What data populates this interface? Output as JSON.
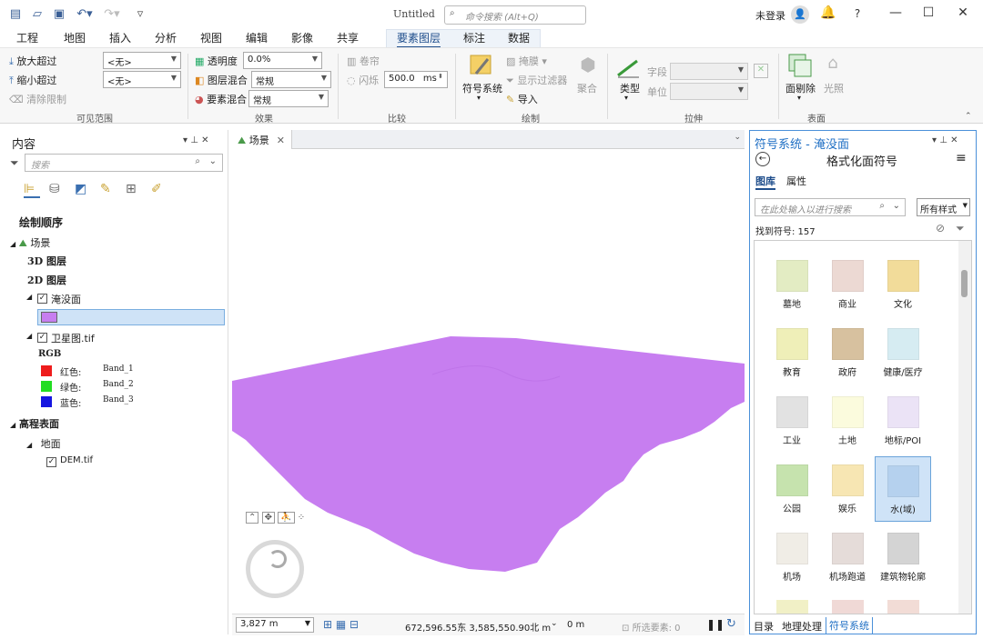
{
  "app": {
    "title": "Untitled",
    "search_placeholder": "命令搜索 (Alt+Q)",
    "user": "未登录",
    "help": "?"
  },
  "tabs": [
    "工程",
    "地图",
    "插入",
    "分析",
    "视图",
    "编辑",
    "影像",
    "共享",
    "要素图层",
    "标注",
    "数据"
  ],
  "active_tab": "要素图层",
  "ribbon": {
    "zoom_in": "放大超过",
    "zoom_out": "缩小超过",
    "clear_limits": "清除限制",
    "zoom_in_value": "<无>",
    "zoom_out_value": "<无>",
    "group_visible": "可见范围",
    "transparency": "透明度",
    "transparency_value": "0.0%",
    "layer_blend": "图层混合",
    "layer_blend_value": "常规",
    "feature_blend": "要素混合",
    "feature_blend_value": "常规",
    "group_effects": "效果",
    "swipe": "卷帘",
    "flicker": "闪烁",
    "flicker_value": "500.0",
    "flicker_unit": "ms",
    "group_compare": "比较",
    "symbology": "符号系统",
    "mask": "掩膜",
    "display_filter": "显示过滤器",
    "import": "导入",
    "aggregate": "聚合",
    "group_draw": "绘制",
    "type": "类型",
    "field": "字段",
    "unit": "单位",
    "group_extrusion": "拉伸",
    "face_culling": "面剔除",
    "lighting": "光照",
    "group_surface": "表面"
  },
  "contents": {
    "title": "内容",
    "search_placeholder": "搜索",
    "draw_order": "绘制顺序",
    "scene": "场景",
    "layers3d": "3D 图层",
    "layers2d": "2D 图层",
    "flood_layer": "淹没面",
    "sat_layer": "卫星图.tif",
    "rgb": "RGB",
    "bands": [
      {
        "label": "红色:",
        "band": "Band_1",
        "color": "#ee1c1c"
      },
      {
        "label": "绿色:",
        "band": "Band_2",
        "color": "#22dd22"
      },
      {
        "label": "蓝色:",
        "band": "Band_3",
        "color": "#1515e0"
      }
    ],
    "elevation": "高程表面",
    "ground": "地面",
    "dem": "DEM.tif",
    "flood_color": "#c77ef0"
  },
  "view": {
    "tab": "场景",
    "scale": "3,827 m",
    "coords": "672,596.55东 3,585,550.90北 m",
    "height": "0 m",
    "selected": "所选要素: 0"
  },
  "symbology": {
    "title": "符号系统 - 淹没面",
    "subtitle": "格式化面符号",
    "tab_gallery": "图库",
    "tab_properties": "属性",
    "search_placeholder": "在此处输入以进行搜索",
    "style_filter": "所有样式",
    "found": "找到符号: 157",
    "symbols": [
      {
        "label": "墓地",
        "color": "#e3ecc3"
      },
      {
        "label": "商业",
        "color": "#ecd9d3"
      },
      {
        "label": "文化",
        "color": "#f2dc9a"
      },
      {
        "label": "教育",
        "color": "#efefb8"
      },
      {
        "label": "政府",
        "color": "#d7c19f"
      },
      {
        "label": "健康/医疗",
        "color": "#d6ecf2"
      },
      {
        "label": "工业",
        "color": "#e2e2e2"
      },
      {
        "label": "土地",
        "color": "#fbfbdd"
      },
      {
        "label": "地标/POI",
        "color": "#ebe3f6"
      },
      {
        "label": "公园",
        "color": "#c6e3ae"
      },
      {
        "label": "娱乐",
        "color": "#f7e6b3"
      },
      {
        "label": "水(域)",
        "color": "#b5d1ee"
      },
      {
        "label": "机场",
        "color": "#f0ede6"
      },
      {
        "label": "机场跑道",
        "color": "#e5dcd9"
      },
      {
        "label": "建筑物轮廓",
        "color": "#d4d4d4"
      }
    ],
    "bottom_tabs": [
      "目录",
      "地理处理",
      "符号系统"
    ]
  }
}
